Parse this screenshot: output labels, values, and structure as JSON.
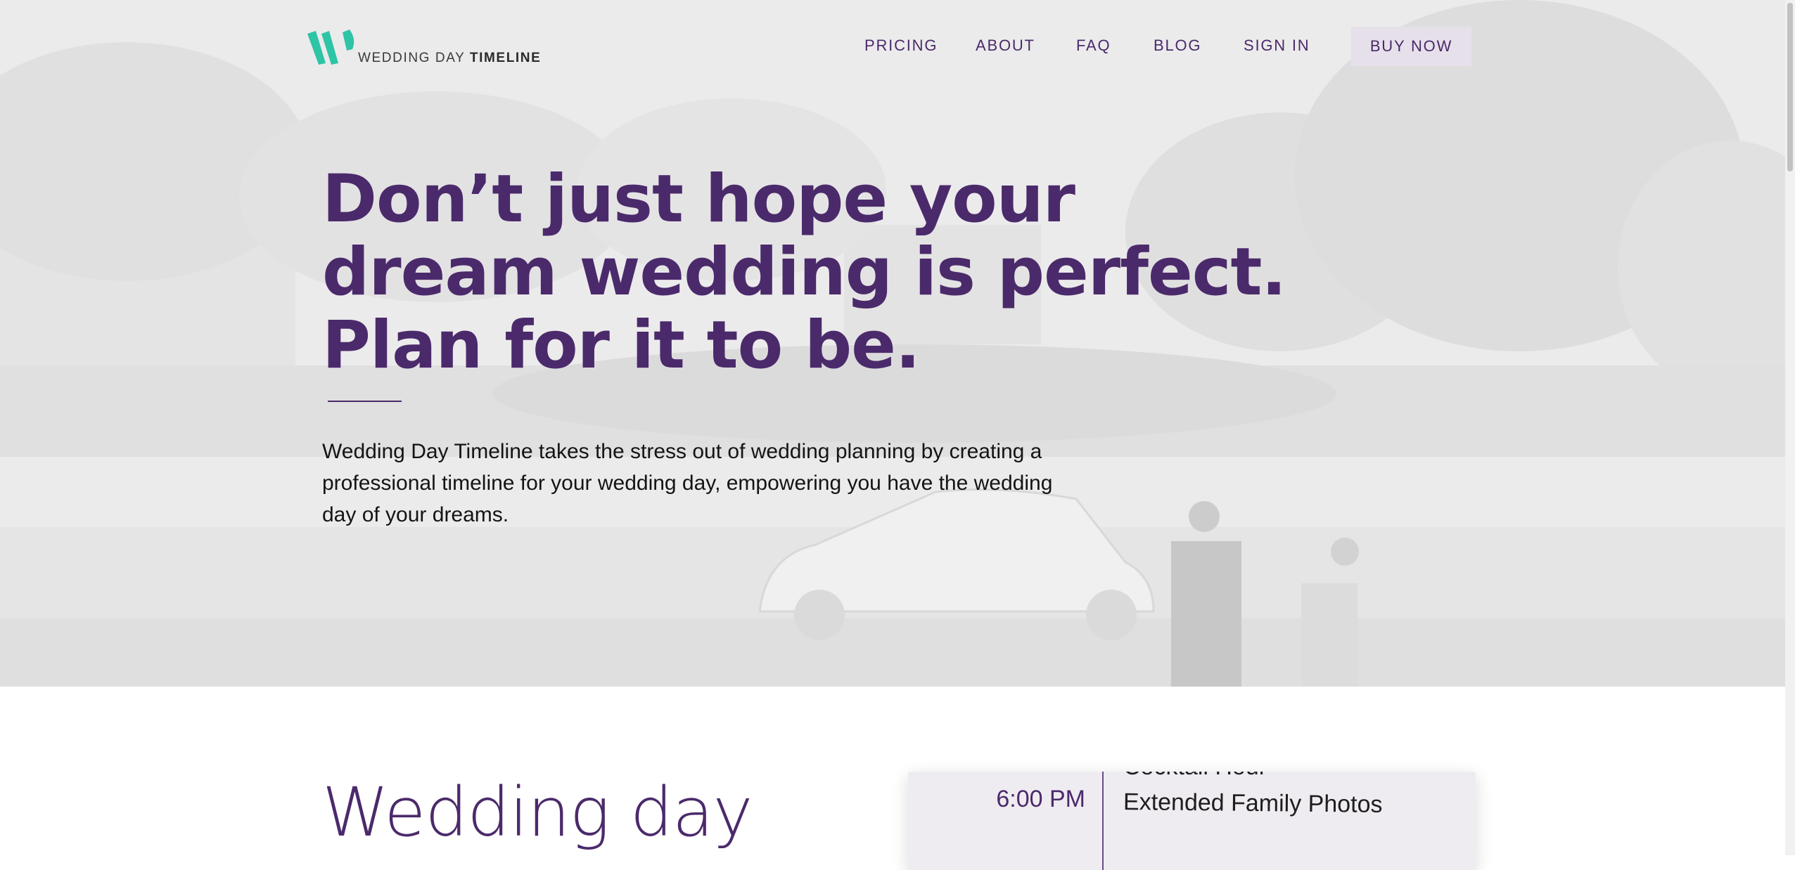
{
  "brand": {
    "name_light": "WEDDING DAY",
    "name_bold": "TIMELINE",
    "colors": {
      "teal": "#2ec4a6",
      "purple": "#4b2a6b",
      "button_bg": "#e6e0ea"
    }
  },
  "nav": {
    "items": [
      {
        "label": "PRICING"
      },
      {
        "label": "ABOUT"
      },
      {
        "label": "FAQ"
      },
      {
        "label": "BLOG"
      },
      {
        "label": "SIGN IN"
      }
    ],
    "cta_label": "BUY NOW"
  },
  "hero": {
    "headline_lines": [
      "Don’t just hope your",
      "dream wedding is perfect.",
      "Plan for it to be."
    ],
    "description": "Wedding Day Timeline takes the stress out of wedding planning by creating a professional timeline for your wedding day, empowering you have the wedding day of your dreams.",
    "background": "black-and-white photo of a couple holding hands beside a vintage car in a garden"
  },
  "section": {
    "title": "Wedding day"
  },
  "timeline": {
    "previous_event": "Cocktail Hour",
    "entries": [
      {
        "time": "6:00 PM",
        "event": "Extended Family Photos"
      }
    ]
  }
}
